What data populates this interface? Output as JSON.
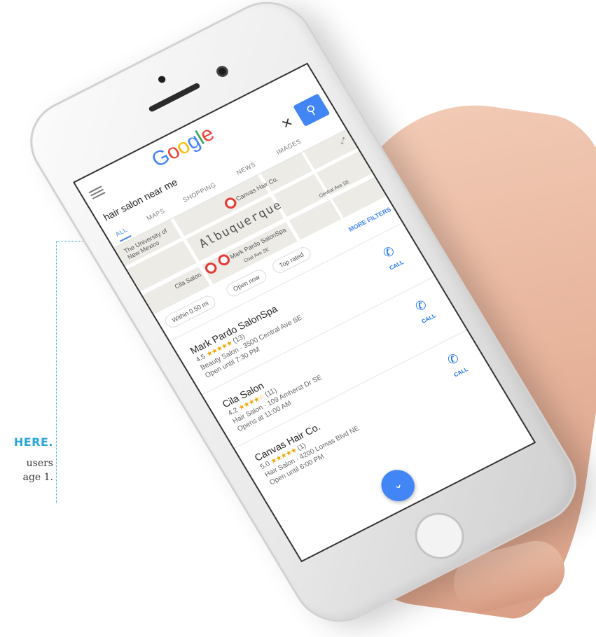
{
  "callout": {
    "title": "HERE.",
    "line1": "users",
    "line2": "age 1."
  },
  "google": {
    "logo_letters": [
      "G",
      "o",
      "o",
      "g",
      "l",
      "e"
    ],
    "search_query": "hair salon near me",
    "tabs": [
      "ALL",
      "MAPS",
      "SHOPPING",
      "NEWS",
      "IMAGES"
    ],
    "active_tab": "ALL"
  },
  "map": {
    "city": "Albuquerque",
    "place_university": "The University of New Mexico",
    "place_canvas": "Canvas Hair Co.",
    "place_cila": "Cila Salon",
    "place_mark": "Mark Pardo SalonSpa",
    "street_central": "Central Ave SE",
    "street_coal": "Coal Ave SE"
  },
  "filters": {
    "chips": [
      "Within 0.50 mi",
      "Open now",
      "Top rated"
    ],
    "more": "MORE FILTERS"
  },
  "results": [
    {
      "name": "Mark Pardo SalonSpa",
      "rating": "4.5",
      "stars": "★★★★★",
      "count": "(13)",
      "type_addr": "Beauty Salon · 3500 Central Ave SE",
      "hours": "Open until 7:30 PM",
      "call": "CALL"
    },
    {
      "name": "Cila Salon",
      "rating": "4.2",
      "stars": "★★★★☆",
      "count": "(11)",
      "type_addr": "Hair Salon · 109 Amherst Dr SE",
      "hours": "Opens at 11:00 AM",
      "call": "CALL"
    },
    {
      "name": "Canvas Hair Co.",
      "rating": "5.0",
      "stars": "★★★★★",
      "count": "(1)",
      "type_addr": "Hair Salon · 4200 Lomas Blvd NE",
      "hours": "Open until 6:00 PM",
      "call": "CALL"
    }
  ],
  "icons": {
    "menu": "menu-icon",
    "clear": "✕",
    "search": "⚲",
    "phone": "✆",
    "expand": "⤢",
    "chevron": "⌄"
  },
  "colors": {
    "google_blue": "#4285F4",
    "google_red": "#EA4335",
    "google_yellow": "#FBBC05",
    "google_green": "#34A853",
    "callout_blue": "#2aa6d8",
    "star": "#f2a600"
  }
}
